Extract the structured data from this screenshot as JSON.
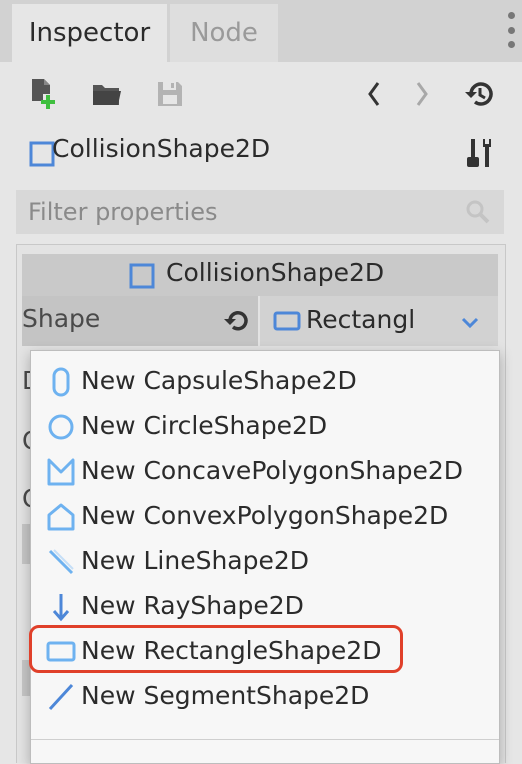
{
  "tabs": [
    {
      "label": "Inspector",
      "active": true
    },
    {
      "label": "Node",
      "active": false
    }
  ],
  "toolbar": {
    "icons": [
      "new-resource-icon",
      "open-folder-icon",
      "save-icon",
      "history-back-icon",
      "history-forward-icon",
      "recent-history-icon"
    ]
  },
  "node": {
    "name": "CollisionShape2D",
    "icon": "collision-shape-2d-icon",
    "tools_icon": "object-tools-icon"
  },
  "filter": {
    "placeholder": "Filter properties",
    "icon": "search-icon"
  },
  "section": {
    "title": "CollisionShape2D"
  },
  "property": {
    "label": "Shape",
    "reset_icon": "revert-icon",
    "value": "Rectangl",
    "dropdown_icon": "chevron-down-icon"
  },
  "background_rows": [
    {
      "label": "D"
    },
    {
      "label": "O"
    },
    {
      "label": "O"
    }
  ],
  "menu": {
    "items": [
      {
        "label": "New CapsuleShape2D",
        "icon": "capsule-shape-icon"
      },
      {
        "label": "New CircleShape2D",
        "icon": "circle-shape-icon"
      },
      {
        "label": "New ConcavePolygonShape2D",
        "icon": "concave-polygon-shape-icon"
      },
      {
        "label": "New ConvexPolygonShape2D",
        "icon": "convex-polygon-shape-icon"
      },
      {
        "label": "New LineShape2D",
        "icon": "line-shape-icon"
      },
      {
        "label": "New RayShape2D",
        "icon": "ray-shape-icon"
      },
      {
        "label": "New RectangleShape2D",
        "icon": "rectangle-shape-icon",
        "highlighted": true
      },
      {
        "label": "New SegmentShape2D",
        "icon": "segment-shape-icon"
      }
    ]
  },
  "colors": {
    "accent_blue": "#4d87d8",
    "shape_blue": "#6eb2f0",
    "green_plus": "#3fbf3f",
    "highlight_red": "#e0402a"
  }
}
